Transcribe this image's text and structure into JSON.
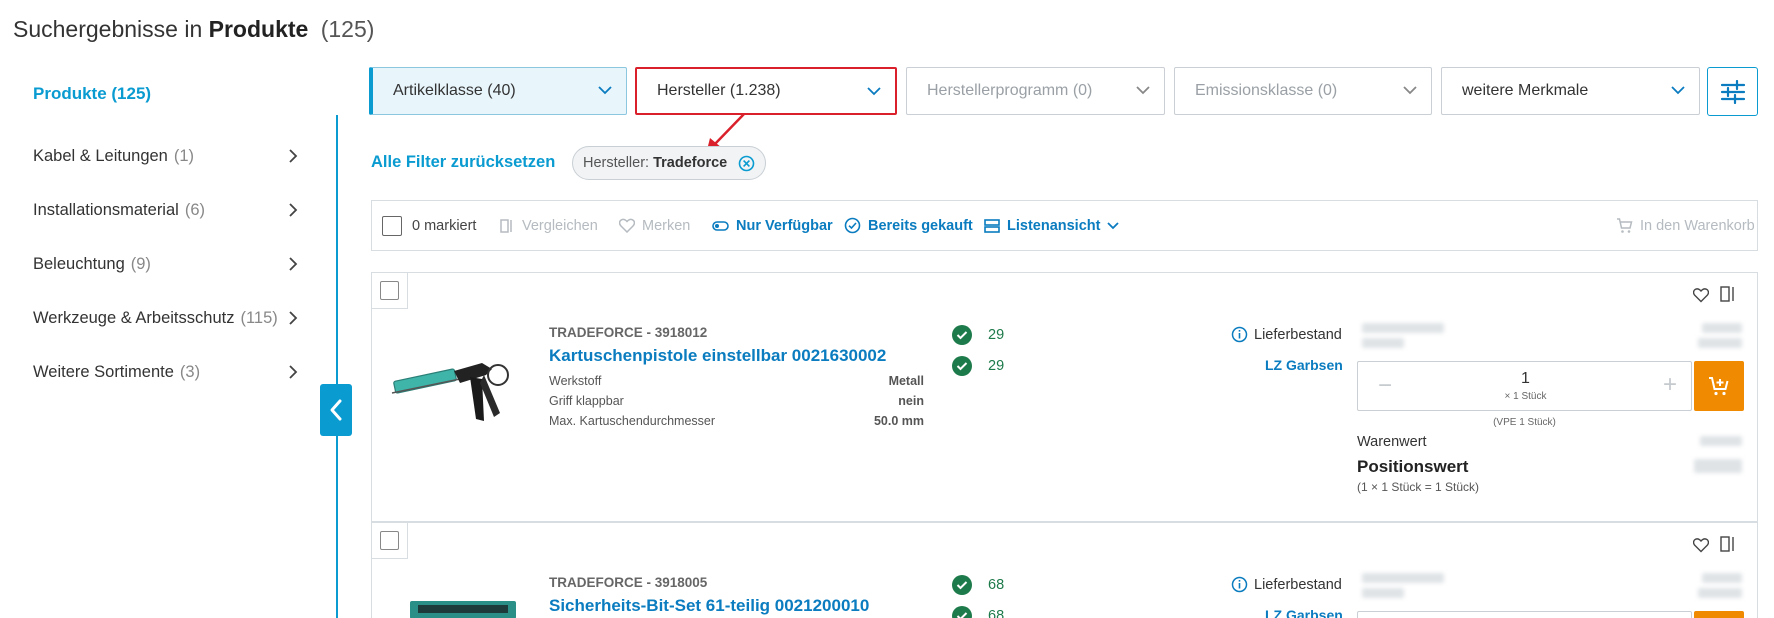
{
  "header": {
    "title_prefix": "Suchergebnisse in",
    "title_category": "Produkte",
    "title_count": "(125)"
  },
  "sidebar": {
    "active": "Produkte (125)",
    "items": [
      {
        "label": "Kabel & Leitungen",
        "count": "(1)"
      },
      {
        "label": "Installationsmaterial",
        "count": "(6)"
      },
      {
        "label": "Beleuchtung",
        "count": "(9)"
      },
      {
        "label": "Werkzeuge & Arbeitsschutz",
        "count": "(115)"
      },
      {
        "label": "Weitere Sortimente",
        "count": "(3)"
      }
    ]
  },
  "filters": [
    {
      "label": "Artikelklasse (40)"
    },
    {
      "label": "Hersteller (1.238)"
    },
    {
      "label": "Herstellerprogramm (0)"
    },
    {
      "label": "Emissionsklasse (0)"
    },
    {
      "label": "weitere Merkmale"
    }
  ],
  "reset_label": "Alle Filter zurücksetzen",
  "chip": {
    "key": "Hersteller:",
    "value": "Tradeforce"
  },
  "toolbar": {
    "marked": "0 markiert",
    "compare": "Vergleichen",
    "remember": "Merken",
    "available": "Nur Verfügbar",
    "bought": "Bereits gekauft",
    "view": "Listenansicht",
    "cart": "In den Warenkorb"
  },
  "colors": {
    "accent": "#0a9bd1",
    "link": "#0a7cbf",
    "stock": "#1d7a4a",
    "cart": "#f08a00",
    "highlight": "#d9202b"
  },
  "products": [
    {
      "brand": "TRADEFORCE - 3918012",
      "name": "Kartuschenpistole einstellbar 0021630002",
      "attrs": [
        {
          "k": "Werkstoff",
          "v": "Metall"
        },
        {
          "k": "Griff klappbar",
          "v": "nein"
        },
        {
          "k": "Max. Kartuschendurchmesser",
          "v": "50.0 mm"
        }
      ],
      "stock": [
        "29",
        "29"
      ],
      "lieferbestand": "Lieferbestand",
      "lz": "LZ Garbsen",
      "qty": "1",
      "qty_unit": "× 1 Stück",
      "vpe": "(VPE 1 Stück)",
      "warenwert": "Warenwert",
      "positionswert": "Positionswert",
      "positionswert_sub": "(1 × 1 Stück = 1 Stück)"
    },
    {
      "brand": "TRADEFORCE - 3918005",
      "name": "Sicherheits-Bit-Set 61-teilig 0021200010",
      "stock": [
        "68",
        "68"
      ],
      "lieferbestand": "Lieferbestand",
      "lz": "LZ Garbsen"
    }
  ]
}
